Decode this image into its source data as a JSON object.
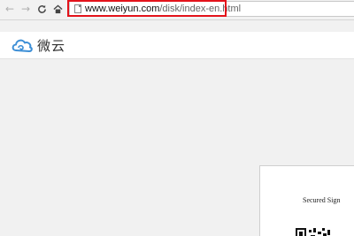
{
  "browser": {
    "url_host": "www.weiyun.com",
    "url_path": "/disk/index-en.html"
  },
  "site": {
    "logo_text": "微云"
  },
  "panel": {
    "text": "Secured Sign"
  }
}
